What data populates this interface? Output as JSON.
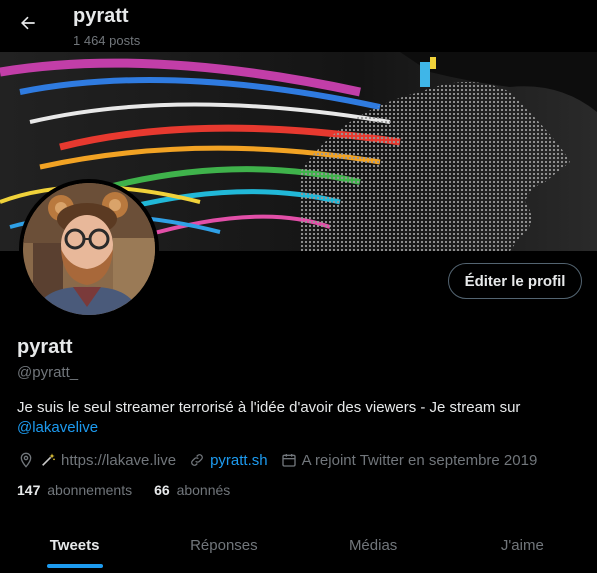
{
  "header": {
    "title": "pyratt",
    "subtitle": "1 464 posts"
  },
  "icons": {
    "back": "arrow-left-icon",
    "location": "location-pin-icon",
    "wand": "magic-wand-icon",
    "link": "link-icon",
    "calendar": "calendar-icon"
  },
  "profile": {
    "edit_label": "Éditer le profil",
    "name": "pyratt",
    "handle": "@pyratt_",
    "bio_text": "Je suis le seul streamer terrorisé à l'idée d'avoir des viewers - Je stream sur",
    "bio_mention": "@lakavelive",
    "location": "https://lakave.live",
    "website": "pyratt.sh",
    "joined": "A rejoint Twitter en septembre 2019",
    "following_count": "147",
    "following_label": "abonnements",
    "followers_count": "66",
    "followers_label": "abonnés"
  },
  "tabs": [
    {
      "label": "Tweets",
      "active": true
    },
    {
      "label": "Réponses",
      "active": false
    },
    {
      "label": "Médias",
      "active": false
    },
    {
      "label": "J'aime",
      "active": false
    }
  ],
  "colors": {
    "background": "#000000",
    "text": "#e7e9ea",
    "muted": "#71767b",
    "accent": "#1d9bf0",
    "border": "#536471"
  }
}
